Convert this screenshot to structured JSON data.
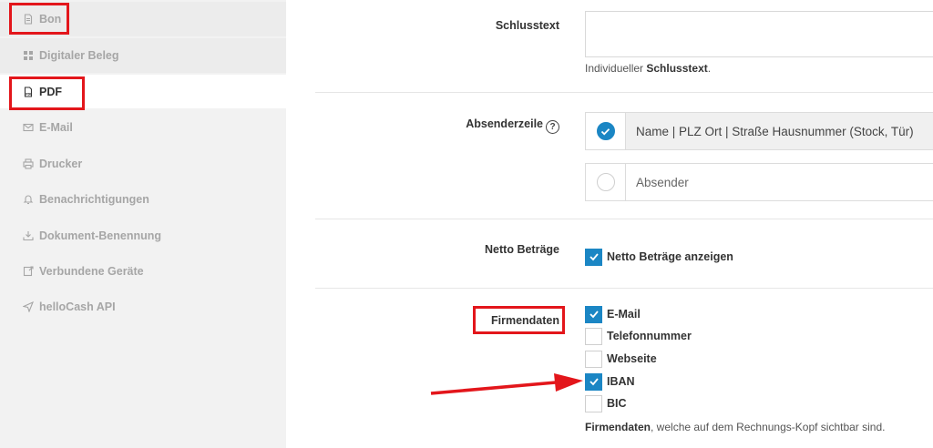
{
  "sidebar": {
    "items": [
      {
        "label": "Bon",
        "icon": "file-text-icon"
      },
      {
        "label": "Digitaler Beleg",
        "icon": "grid-icon"
      },
      {
        "label": "PDF",
        "icon": "pdf-file-icon"
      },
      {
        "label": "E-Mail",
        "icon": "envelope-icon"
      },
      {
        "label": "Drucker",
        "icon": "printer-icon"
      },
      {
        "label": "Benachrichtigungen",
        "icon": "bell-icon"
      },
      {
        "label": "Dokument-Benennung",
        "icon": "download-tray-icon"
      },
      {
        "label": "Verbundene Geräte",
        "icon": "device-link-icon"
      },
      {
        "label": "helloCash API",
        "icon": "send-icon"
      }
    ],
    "active": "PDF"
  },
  "schlusstext": {
    "label": "Schlusstext",
    "value": "",
    "help_prefix": "Individueller ",
    "help_bold": "Schlusstext",
    "help_suffix": "."
  },
  "absenderzeile": {
    "label": "Absenderzeile",
    "info_glyph": "?",
    "options": [
      {
        "label": "Name | PLZ Ort | Straße Hausnummer (Stock, Tür)",
        "selected": true
      },
      {
        "label": "Absender",
        "selected": false
      }
    ]
  },
  "netto": {
    "label": "Netto Beträge",
    "checkbox_label": "Netto Beträge anzeigen",
    "checked": true
  },
  "firmendaten": {
    "label": "Firmendaten",
    "options": [
      {
        "label": "E-Mail",
        "checked": true
      },
      {
        "label": "Telefonnummer",
        "checked": false
      },
      {
        "label": "Webseite",
        "checked": false
      },
      {
        "label": "IBAN",
        "checked": true
      },
      {
        "label": "BIC",
        "checked": false
      }
    ],
    "help_bold": "Firmendaten",
    "help_suffix": ", welche auf dem Rechnungs-Kopf sichtbar sind."
  },
  "colors": {
    "accent": "#1b86c4",
    "annotation": "#e3161b",
    "sidebar_bg": "#f2f2f2"
  }
}
